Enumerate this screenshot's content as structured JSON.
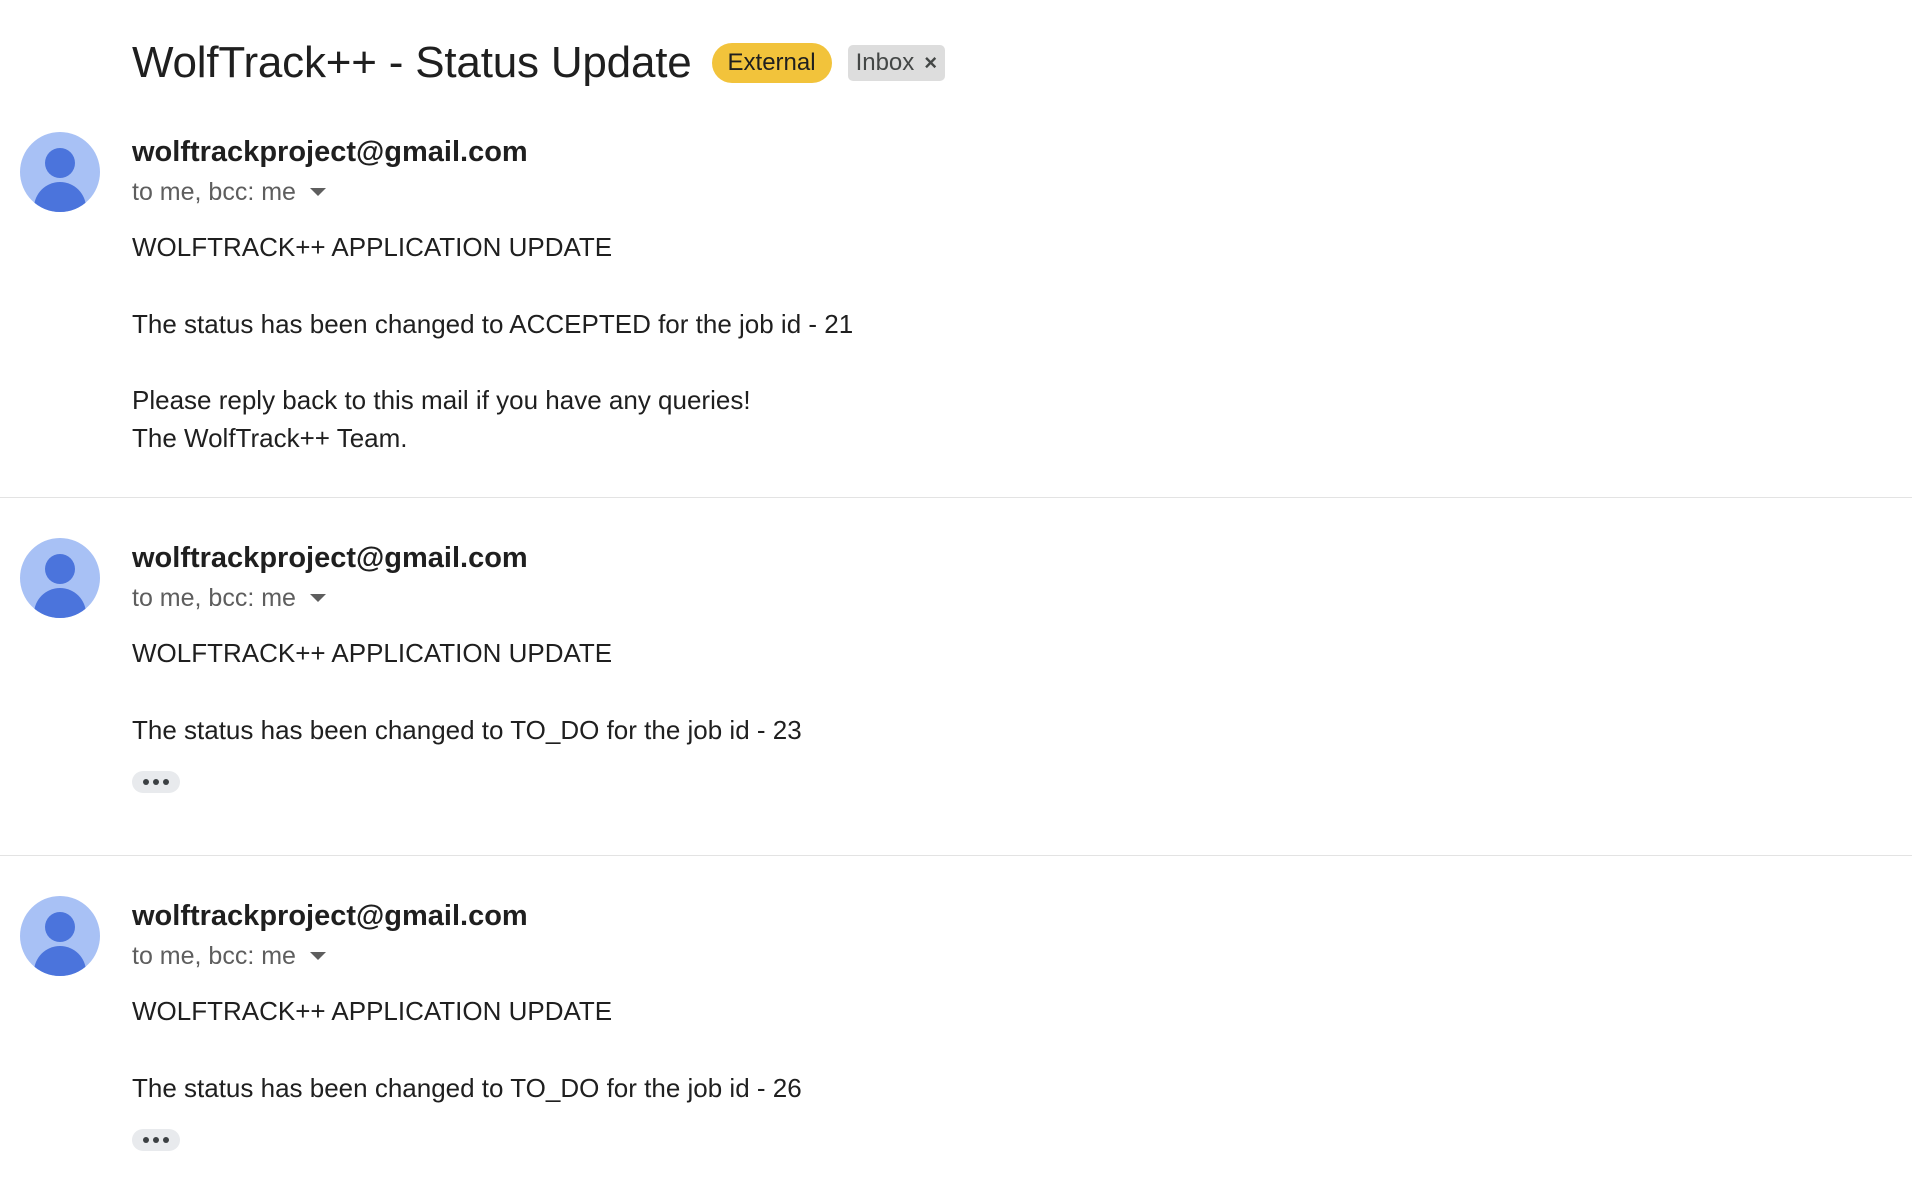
{
  "thread": {
    "subject": "WolfTrack++ - Status Update",
    "labels": {
      "external": "External",
      "inbox": "Inbox",
      "inbox_remove": "×"
    }
  },
  "messages": [
    {
      "sender": "wolftrackproject@gmail.com",
      "recipients": "to me, bcc: me",
      "heading": "WOLFTRACK++ APPLICATION UPDATE",
      "status_line": "The status has been changed to ACCEPTED for the job id - 21",
      "reply_line": "Please reply back to this mail if you have any queries!",
      "signature": "The WolfTrack++ Team."
    },
    {
      "sender": "wolftrackproject@gmail.com",
      "recipients": "to me, bcc: me",
      "heading": "WOLFTRACK++ APPLICATION UPDATE",
      "status_line": "The status has been changed to TO_DO for the job id - 23"
    },
    {
      "sender": "wolftrackproject@gmail.com",
      "recipients": "to me, bcc: me",
      "heading": "WOLFTRACK++ APPLICATION UPDATE",
      "status_line": "The status has been changed to TO_DO for the job id - 26"
    }
  ],
  "colors": {
    "external_label": "#f2c33b",
    "inbox_label": "#dddddd",
    "avatar_bg": "#a8c1f5",
    "avatar_fg": "#4b74dc"
  },
  "icons": {
    "avatar": "default-person-avatar-icon",
    "recipients_toggle": "caret-down-icon",
    "trimmed_content": "more-horiz-icon",
    "remove_label": "close-icon"
  }
}
